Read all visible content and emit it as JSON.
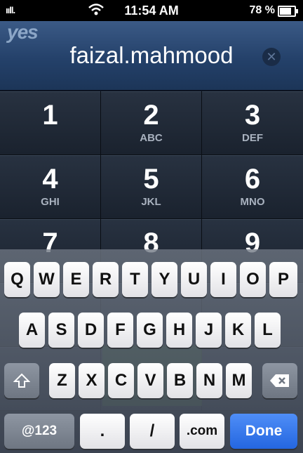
{
  "status_bar": {
    "signal": "ııll.",
    "time": "11:54 AM",
    "battery": "78 %",
    "battery_level": 0.78
  },
  "header": {
    "logo": "yes",
    "entry_text": "faizal.mahmood",
    "clear_glyph": "✕"
  },
  "dialpad": {
    "keys": [
      {
        "num": "1",
        "letters": ""
      },
      {
        "num": "2",
        "letters": "ABC"
      },
      {
        "num": "3",
        "letters": "DEF"
      },
      {
        "num": "4",
        "letters": "GHI"
      },
      {
        "num": "5",
        "letters": "JKL"
      },
      {
        "num": "6",
        "letters": "MNO"
      },
      {
        "num": "7",
        "letters": ""
      },
      {
        "num": "8",
        "letters": ""
      },
      {
        "num": "9",
        "letters": ""
      }
    ]
  },
  "keyboard": {
    "row1": [
      "Q",
      "W",
      "E",
      "R",
      "T",
      "Y",
      "U",
      "I",
      "O",
      "P"
    ],
    "row2": [
      "A",
      "S",
      "D",
      "F",
      "G",
      "H",
      "J",
      "K",
      "L"
    ],
    "row3": [
      "Z",
      "X",
      "C",
      "V",
      "B",
      "N",
      "M"
    ],
    "shift_icon": "shift-icon",
    "backspace_icon": "backspace-icon",
    "mode_label": "@123",
    "dot_label": ".",
    "slash_label": "/",
    "com_label": ".com",
    "done_label": "Done"
  }
}
